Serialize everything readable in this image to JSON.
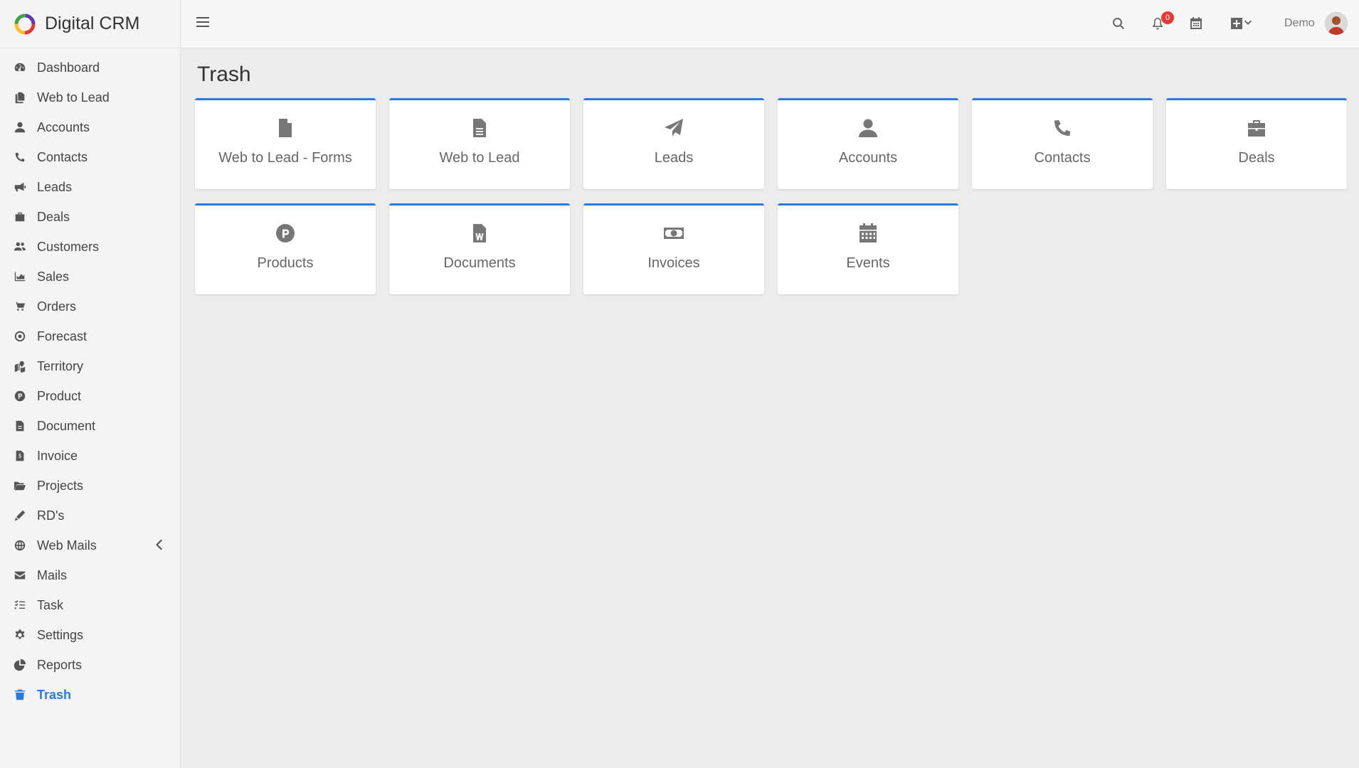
{
  "brand": {
    "name": "Digital CRM"
  },
  "sidebar": {
    "items": [
      {
        "label": "Dashboard",
        "icon": "dashboard-icon"
      },
      {
        "label": "Web to Lead",
        "icon": "copy-icon"
      },
      {
        "label": "Accounts",
        "icon": "user-icon"
      },
      {
        "label": "Contacts",
        "icon": "phone-icon"
      },
      {
        "label": "Leads",
        "icon": "megaphone-icon"
      },
      {
        "label": "Deals",
        "icon": "briefcase-icon"
      },
      {
        "label": "Customers",
        "icon": "users-icon"
      },
      {
        "label": "Sales",
        "icon": "area-chart-icon"
      },
      {
        "label": "Orders",
        "icon": "cart-icon"
      },
      {
        "label": "Forecast",
        "icon": "target-icon"
      },
      {
        "label": "Territory",
        "icon": "map-icon"
      },
      {
        "label": "Product",
        "icon": "product-p-icon"
      },
      {
        "label": "Document",
        "icon": "document-icon"
      },
      {
        "label": "Invoice",
        "icon": "invoice-icon"
      },
      {
        "label": "Projects",
        "icon": "folder-open-icon"
      },
      {
        "label": "RD's",
        "icon": "pen-icon"
      },
      {
        "label": "Web Mails",
        "icon": "globe-icon"
      },
      {
        "label": "Mails",
        "icon": "envelope-icon"
      },
      {
        "label": "Task",
        "icon": "tasks-icon"
      },
      {
        "label": "Settings",
        "icon": "gear-icon"
      },
      {
        "label": "Reports",
        "icon": "pie-chart-icon"
      },
      {
        "label": "Trash",
        "icon": "trash-icon",
        "active": true
      }
    ]
  },
  "topbar": {
    "notifications_count": "0",
    "user_name": "Demo"
  },
  "page": {
    "title": "Trash"
  },
  "cards": [
    {
      "label": "Web to Lead - Forms",
      "icon": "file-icon"
    },
    {
      "label": "Web to Lead",
      "icon": "file-lines-icon"
    },
    {
      "label": "Leads",
      "icon": "paper-plane-icon"
    },
    {
      "label": "Accounts",
      "icon": "user-icon"
    },
    {
      "label": "Contacts",
      "icon": "phone-icon"
    },
    {
      "label": "Deals",
      "icon": "briefcase-icon"
    },
    {
      "label": "Products",
      "icon": "product-p-icon"
    },
    {
      "label": "Documents",
      "icon": "word-file-icon"
    },
    {
      "label": "Invoices",
      "icon": "money-bill-icon"
    },
    {
      "label": "Events",
      "icon": "calendar-icon"
    }
  ],
  "colors": {
    "accent": "#2a7ae2",
    "badge": "#e53935"
  }
}
